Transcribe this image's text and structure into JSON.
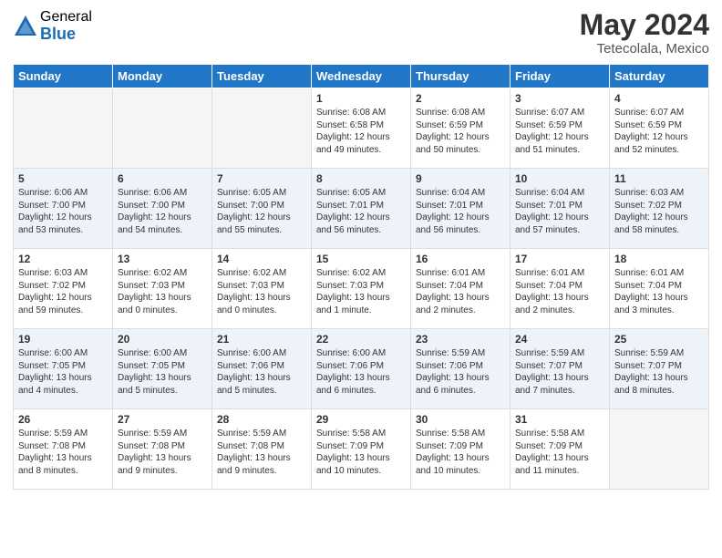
{
  "logo": {
    "general": "General",
    "blue": "Blue"
  },
  "title": "May 2024",
  "location": "Tetecolala, Mexico",
  "days_header": [
    "Sunday",
    "Monday",
    "Tuesday",
    "Wednesday",
    "Thursday",
    "Friday",
    "Saturday"
  ],
  "weeks": [
    [
      {
        "day": "",
        "info": ""
      },
      {
        "day": "",
        "info": ""
      },
      {
        "day": "",
        "info": ""
      },
      {
        "day": "1",
        "info": "Sunrise: 6:08 AM\nSunset: 6:58 PM\nDaylight: 12 hours\nand 49 minutes."
      },
      {
        "day": "2",
        "info": "Sunrise: 6:08 AM\nSunset: 6:59 PM\nDaylight: 12 hours\nand 50 minutes."
      },
      {
        "day": "3",
        "info": "Sunrise: 6:07 AM\nSunset: 6:59 PM\nDaylight: 12 hours\nand 51 minutes."
      },
      {
        "day": "4",
        "info": "Sunrise: 6:07 AM\nSunset: 6:59 PM\nDaylight: 12 hours\nand 52 minutes."
      }
    ],
    [
      {
        "day": "5",
        "info": "Sunrise: 6:06 AM\nSunset: 7:00 PM\nDaylight: 12 hours\nand 53 minutes."
      },
      {
        "day": "6",
        "info": "Sunrise: 6:06 AM\nSunset: 7:00 PM\nDaylight: 12 hours\nand 54 minutes."
      },
      {
        "day": "7",
        "info": "Sunrise: 6:05 AM\nSunset: 7:00 PM\nDaylight: 12 hours\nand 55 minutes."
      },
      {
        "day": "8",
        "info": "Sunrise: 6:05 AM\nSunset: 7:01 PM\nDaylight: 12 hours\nand 56 minutes."
      },
      {
        "day": "9",
        "info": "Sunrise: 6:04 AM\nSunset: 7:01 PM\nDaylight: 12 hours\nand 56 minutes."
      },
      {
        "day": "10",
        "info": "Sunrise: 6:04 AM\nSunset: 7:01 PM\nDaylight: 12 hours\nand 57 minutes."
      },
      {
        "day": "11",
        "info": "Sunrise: 6:03 AM\nSunset: 7:02 PM\nDaylight: 12 hours\nand 58 minutes."
      }
    ],
    [
      {
        "day": "12",
        "info": "Sunrise: 6:03 AM\nSunset: 7:02 PM\nDaylight: 12 hours\nand 59 minutes."
      },
      {
        "day": "13",
        "info": "Sunrise: 6:02 AM\nSunset: 7:03 PM\nDaylight: 13 hours\nand 0 minutes."
      },
      {
        "day": "14",
        "info": "Sunrise: 6:02 AM\nSunset: 7:03 PM\nDaylight: 13 hours\nand 0 minutes."
      },
      {
        "day": "15",
        "info": "Sunrise: 6:02 AM\nSunset: 7:03 PM\nDaylight: 13 hours\nand 1 minute."
      },
      {
        "day": "16",
        "info": "Sunrise: 6:01 AM\nSunset: 7:04 PM\nDaylight: 13 hours\nand 2 minutes."
      },
      {
        "day": "17",
        "info": "Sunrise: 6:01 AM\nSunset: 7:04 PM\nDaylight: 13 hours\nand 2 minutes."
      },
      {
        "day": "18",
        "info": "Sunrise: 6:01 AM\nSunset: 7:04 PM\nDaylight: 13 hours\nand 3 minutes."
      }
    ],
    [
      {
        "day": "19",
        "info": "Sunrise: 6:00 AM\nSunset: 7:05 PM\nDaylight: 13 hours\nand 4 minutes."
      },
      {
        "day": "20",
        "info": "Sunrise: 6:00 AM\nSunset: 7:05 PM\nDaylight: 13 hours\nand 5 minutes."
      },
      {
        "day": "21",
        "info": "Sunrise: 6:00 AM\nSunset: 7:06 PM\nDaylight: 13 hours\nand 5 minutes."
      },
      {
        "day": "22",
        "info": "Sunrise: 6:00 AM\nSunset: 7:06 PM\nDaylight: 13 hours\nand 6 minutes."
      },
      {
        "day": "23",
        "info": "Sunrise: 5:59 AM\nSunset: 7:06 PM\nDaylight: 13 hours\nand 6 minutes."
      },
      {
        "day": "24",
        "info": "Sunrise: 5:59 AM\nSunset: 7:07 PM\nDaylight: 13 hours\nand 7 minutes."
      },
      {
        "day": "25",
        "info": "Sunrise: 5:59 AM\nSunset: 7:07 PM\nDaylight: 13 hours\nand 8 minutes."
      }
    ],
    [
      {
        "day": "26",
        "info": "Sunrise: 5:59 AM\nSunset: 7:08 PM\nDaylight: 13 hours\nand 8 minutes."
      },
      {
        "day": "27",
        "info": "Sunrise: 5:59 AM\nSunset: 7:08 PM\nDaylight: 13 hours\nand 9 minutes."
      },
      {
        "day": "28",
        "info": "Sunrise: 5:59 AM\nSunset: 7:08 PM\nDaylight: 13 hours\nand 9 minutes."
      },
      {
        "day": "29",
        "info": "Sunrise: 5:58 AM\nSunset: 7:09 PM\nDaylight: 13 hours\nand 10 minutes."
      },
      {
        "day": "30",
        "info": "Sunrise: 5:58 AM\nSunset: 7:09 PM\nDaylight: 13 hours\nand 10 minutes."
      },
      {
        "day": "31",
        "info": "Sunrise: 5:58 AM\nSunset: 7:09 PM\nDaylight: 13 hours\nand 11 minutes."
      },
      {
        "day": "",
        "info": ""
      }
    ]
  ]
}
